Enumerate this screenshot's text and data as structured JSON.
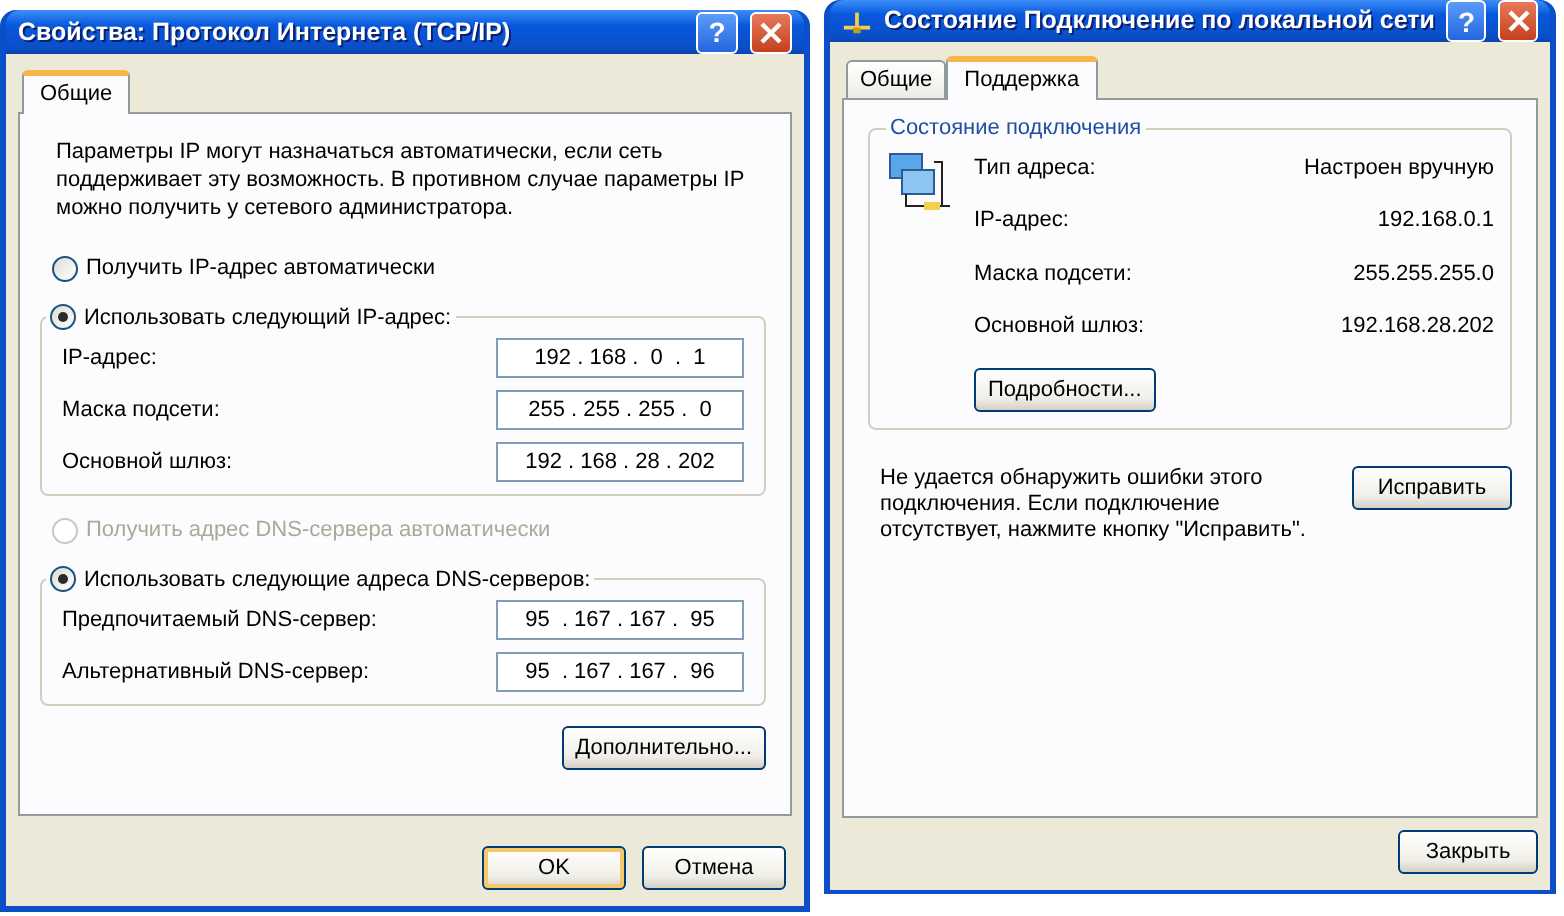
{
  "tcpip_dialog": {
    "title": "Свойства: Протокол Интернета (TCP/IP)",
    "help_label": "?",
    "tabs": [
      {
        "label": "Общие",
        "selected": true
      }
    ],
    "description": "Параметры IP могут назначаться автоматически, если сеть поддерживает эту возможность. В противном случае параметры IP можно получить у сетевого администратора.",
    "ip_options": [
      {
        "label": "Получить IP-адрес автоматически",
        "selected": false,
        "disabled": false
      },
      {
        "label": "Использовать следующий IP-адрес:",
        "selected": true,
        "disabled": false,
        "fields": [
          {
            "label": "IP-адрес:",
            "value": "192 . 168 .  0  .  1"
          },
          {
            "label": "Маска подсети:",
            "value": "255 . 255 . 255 .  0"
          },
          {
            "label": "Основной шлюз:",
            "value": "192 . 168 . 28 . 202"
          }
        ]
      }
    ],
    "dns_options": [
      {
        "label": "Получить адрес DNS-сервера автоматически",
        "selected": false,
        "disabled": true
      },
      {
        "label": "Использовать следующие адреса DNS-серверов:",
        "selected": true,
        "disabled": false,
        "fields": [
          {
            "label": "Предпочитаемый DNS-сервер:",
            "value": "95  . 167 . 167 .  95"
          },
          {
            "label": "Альтернативный DNS-сервер:",
            "value": "95  . 167 . 167 .  96"
          }
        ]
      }
    ],
    "advanced_button": "Дополнительно...",
    "buttons": [
      {
        "label": "OK",
        "default": true
      },
      {
        "label": "Отмена",
        "default": false
      }
    ]
  },
  "status_dialog": {
    "title": "Состояние Подключение по локальной сети",
    "help_label": "?",
    "tabs": [
      {
        "label": "Общие",
        "selected": false
      },
      {
        "label": "Поддержка",
        "selected": true
      }
    ],
    "group_title": "Состояние подключения",
    "rows": [
      {
        "label": "Тип адреса:",
        "value": "Настроен вручную"
      },
      {
        "label": "IP-адрес:",
        "value": "192.168.0.1"
      },
      {
        "label": "Маска подсети:",
        "value": "255.255.255.0"
      },
      {
        "label": "Основной шлюз:",
        "value": "192.168.28.202"
      }
    ],
    "details_button": "Подробности...",
    "message": "Не удается обнаружить ошибки этого подключения. Если подключение отсутствует, нажмите кнопку \"Исправить\".",
    "repair_button": "Исправить",
    "close_button": "Закрыть"
  }
}
